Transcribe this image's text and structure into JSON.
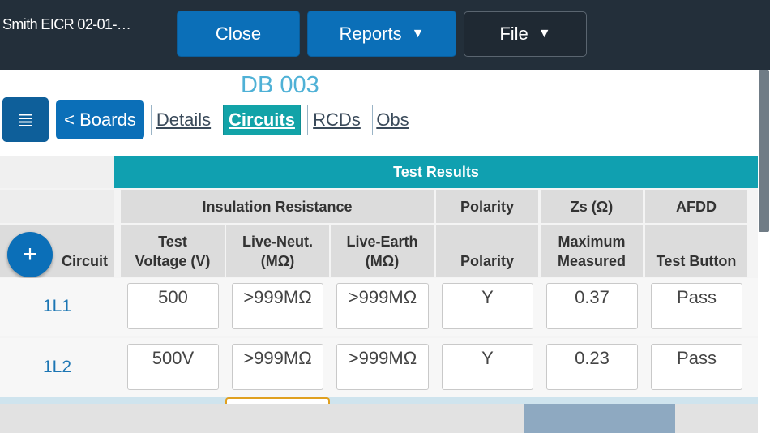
{
  "header": {
    "doc_title": "Smith EICR 02-01-…",
    "close_label": "Close",
    "reports_label": "Reports",
    "file_label": "File"
  },
  "board": {
    "title": "DB 003",
    "boards_label": "< Boards",
    "tabs": [
      {
        "label": "Details",
        "active": false
      },
      {
        "label": "Circuits",
        "active": true
      },
      {
        "label": "RCDs",
        "active": false
      },
      {
        "label": "Obs",
        "active": false
      }
    ]
  },
  "table": {
    "group_title": "Test Results",
    "sections": {
      "insulation": "Insulation Resistance",
      "polarity": "Polarity",
      "zs": "Zs (Ω)",
      "afdd": "AFDD"
    },
    "columns": {
      "circuit": "Circuit",
      "test_voltage": "Test\nVoltage (V)",
      "live_neut": "Live-Neut.\n(MΩ)",
      "live_earth": "Live-Earth\n(MΩ)",
      "polarity": "Polarity",
      "zs_max": "Maximum\nMeasured",
      "afdd_test": "Test Button"
    },
    "rows": [
      {
        "circuit": "1L1",
        "test_voltage": "500",
        "live_neut": ">999MΩ",
        "live_earth": ">999MΩ",
        "polarity": "Y",
        "zs": "0.37",
        "afdd": "Pass"
      },
      {
        "circuit": "1L2",
        "test_voltage": "500V",
        "live_neut": ">999MΩ",
        "live_earth": ">999MΩ",
        "polarity": "Y",
        "zs": "0.23",
        "afdd": "Pass"
      }
    ]
  },
  "colors": {
    "accent": "#0b6fb8",
    "teal": "#10a0b0",
    "topbar": "#232f3a"
  }
}
